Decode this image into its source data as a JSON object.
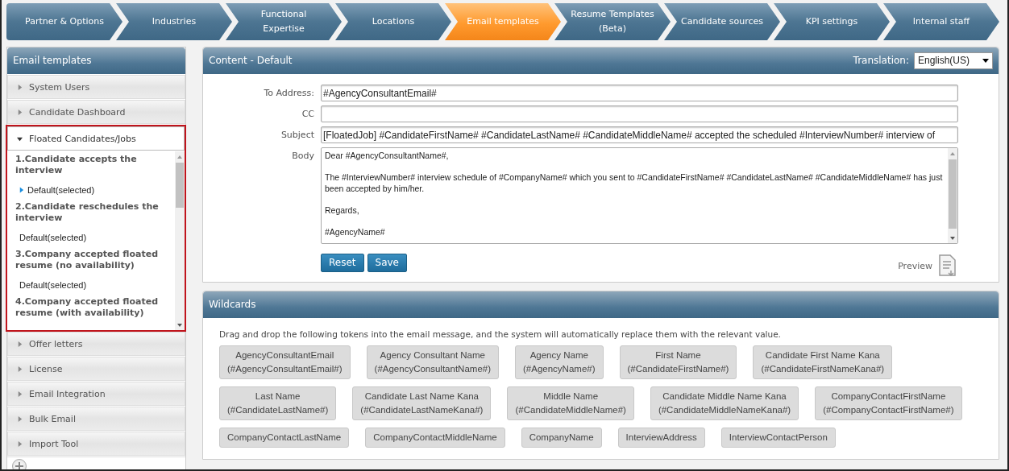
{
  "nav_tabs": [
    {
      "label": "Partner & Options",
      "selected": false
    },
    {
      "label": "Industries",
      "selected": false
    },
    {
      "label": "Functional Expertise",
      "selected": false
    },
    {
      "label": "Locations",
      "selected": false
    },
    {
      "label": "Email templates",
      "selected": true
    },
    {
      "label": "Resume Templates (Beta)",
      "selected": false
    },
    {
      "label": "Candidate sources",
      "selected": false
    },
    {
      "label": "KPI settings",
      "selected": false
    },
    {
      "label": "Internal staff",
      "selected": false
    }
  ],
  "sidebar": {
    "title": "Email templates",
    "items": [
      {
        "label": "System Users",
        "expanded": false,
        "highlighted": false
      },
      {
        "label": "Candidate Dashboard",
        "expanded": false,
        "highlighted": false
      },
      {
        "label": "Floated Candidates/Jobs",
        "expanded": true,
        "highlighted": true,
        "children": [
          {
            "label": "1.Candidate accepts the interview",
            "children": [
              {
                "label": "Default(selected)",
                "selected": true
              }
            ]
          },
          {
            "label": "2.Candidate reschedules the interview",
            "children": [
              {
                "label": "Default(selected)",
                "selected": false
              }
            ]
          },
          {
            "label": "3.Company accepted floated resume (no availability)",
            "children": [
              {
                "label": "Default(selected)",
                "selected": false
              }
            ]
          },
          {
            "label": "4.Company accepted floated resume (with availability)"
          }
        ]
      },
      {
        "label": "Offer letters",
        "expanded": false,
        "highlighted": false
      },
      {
        "label": "License",
        "expanded": false,
        "highlighted": false
      },
      {
        "label": "Email Integration",
        "expanded": false,
        "highlighted": false
      },
      {
        "label": "Bulk Email",
        "expanded": false,
        "highlighted": false
      },
      {
        "label": "Import Tool",
        "expanded": false,
        "highlighted": false
      }
    ]
  },
  "content": {
    "title": "Content - Default",
    "translation_label": "Translation:",
    "translation_value": "English(US)",
    "fields": [
      {
        "label": "To Address:",
        "value": "#AgencyConsultantEmail#"
      },
      {
        "label": "CC"
      },
      {
        "label": "Subject",
        "value": "[FloatedJob] #CandidateFirstName# #CandidateLastName# #CandidateMiddleName# accepted the scheduled #InterviewNumber# interview of"
      }
    ],
    "body_label": "Body",
    "body_paragraphs": [
      "Dear #AgencyConsultantName#,",
      "The #InterviewNumber# interview schedule of #CompanyName# which you sent to #CandidateFirstName# #CandidateLastName# #CandidateMiddleName# has just been accepted by him/her.",
      "Regards,",
      "#AgencyName#"
    ],
    "buttons": [
      "Reset",
      "Save"
    ],
    "preview_label": "Preview"
  },
  "wildcards": {
    "title": "Wildcards",
    "description": "Drag and drop the following tokens into the email message, and the system will automatically replace them with the relevant value.",
    "tokens": [
      {
        "name": "AgencyConsultantEmail",
        "token": "(#AgencyConsultantEmail#)"
      },
      {
        "name": "Agency Consultant Name",
        "token": "(#AgencyConsultantName#)"
      },
      {
        "name": "Agency Name",
        "token": "(#AgencyName#)"
      },
      {
        "name": "First Name",
        "token": "(#CandidateFirstName#)"
      },
      {
        "name": "Candidate First Name Kana",
        "token": "(#CandidateFirstNameKana#)"
      },
      {
        "name": "Last Name",
        "token": "(#CandidateLastName#)"
      },
      {
        "name": "Candidate Last Name Kana",
        "token": "(#CandidateLastNameKana#)"
      },
      {
        "name": "Middle Name",
        "token": "(#CandidateMiddleName#)"
      },
      {
        "name": "Candidate Middle Name Kana",
        "token": "(#CandidateMiddleNameKana#)"
      },
      {
        "name": "CompanyContactFirstName",
        "token": "(#CompanyContactFirstName#)"
      },
      {
        "name": "CompanyContactLastName"
      },
      {
        "name": "CompanyContactMiddleName"
      },
      {
        "name": "CompanyName"
      },
      {
        "name": "InterviewAddress"
      },
      {
        "name": "InterviewContactPerson"
      }
    ]
  }
}
